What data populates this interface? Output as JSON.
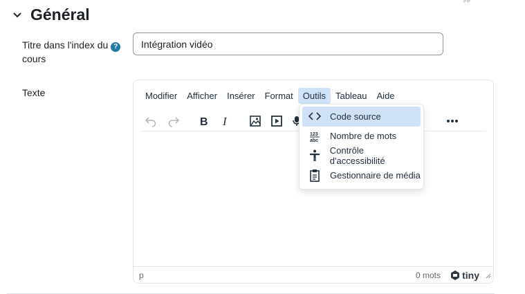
{
  "edge_mark": "ᵖᵖ",
  "section": {
    "title": "Général"
  },
  "title_field": {
    "label_line1": "Titre dans l'index du",
    "label_line2": "cours",
    "help": "?",
    "value": "Intégration vidéo"
  },
  "text_field": {
    "label": "Texte"
  },
  "editor": {
    "menu": [
      "Modifier",
      "Afficher",
      "Insérer",
      "Format",
      "Outils",
      "Tableau",
      "Aide"
    ],
    "active_menu": "Outils",
    "toolbar_icons": [
      "undo-icon",
      "redo-icon",
      "bold-icon",
      "italic-icon",
      "image-icon",
      "media-icon",
      "microphone-icon",
      "more-icon"
    ],
    "status_path": "p",
    "word_count": "0 mots",
    "brand": "tiny"
  },
  "dropdown": {
    "items": [
      {
        "label": "Code source",
        "icon": "code-icon"
      },
      {
        "label": "Nombre de mots",
        "icon": "word-count-icon"
      },
      {
        "label": "Contrôle d'accessibilité",
        "icon": "accessibility-icon"
      },
      {
        "label": "Gestionnaire de média",
        "icon": "media-manager-icon"
      }
    ]
  },
  "colors": {
    "accent": "#cfe2f7",
    "help": "#1f7aa6",
    "text": "#1d2125",
    "editor_text": "#222f3e"
  }
}
